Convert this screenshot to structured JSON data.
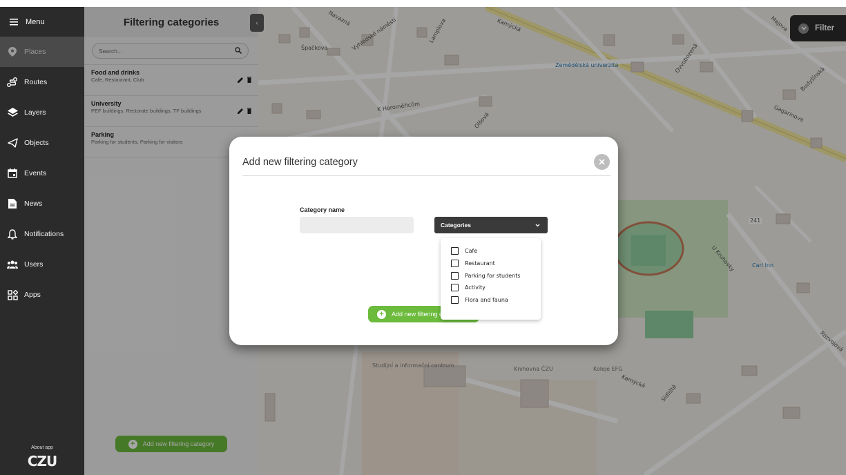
{
  "menu": {
    "title": "Menu",
    "items": [
      {
        "label": "Places",
        "icon": "map-pin-icon",
        "active": true
      },
      {
        "label": "Routes",
        "icon": "route-icon"
      },
      {
        "label": "Layers",
        "icon": "layers-icon"
      },
      {
        "label": "Objects",
        "icon": "objects-icon"
      },
      {
        "label": "Events",
        "icon": "calendar-icon"
      },
      {
        "label": "News",
        "icon": "news-icon"
      },
      {
        "label": "Notifications",
        "icon": "bell-icon"
      },
      {
        "label": "Users",
        "icon": "users-icon"
      },
      {
        "label": "Apps",
        "icon": "apps-icon"
      }
    ],
    "about": "About app",
    "logo": "CZU"
  },
  "panel": {
    "title": "Filtering categories",
    "search_placeholder": "Search...",
    "categories": [
      {
        "title": "Food and drinks",
        "subtitle": "Cafe, Restaurant, Club"
      },
      {
        "title": "University",
        "subtitle": "PEF buildings, Rectorate buildings, TF buildings"
      },
      {
        "title": "Parking",
        "subtitle": "Parking for students, Parking for visitors"
      }
    ],
    "add_button": "Add new filtering category"
  },
  "modal": {
    "title": "Add new filtering category",
    "category_name_label": "Category name",
    "category_name_value": "",
    "dropdown_label": "Categories",
    "options": [
      "Cafe",
      "Restaurant",
      "Parking for students",
      "Activity",
      "Flora and fauna"
    ],
    "add_button": "Add new filtering category"
  },
  "filter_button": "Filter",
  "map_labels": {
    "l1": "Špačkova",
    "l2": "Vyhledské náměstí",
    "l3": "Navazná",
    "l4": "Lamplova",
    "l5": "Kamýcká",
    "l6": "K Horoměřicům",
    "l7": "Zemědělská univerzita",
    "l8": "Olšová",
    "l9": "Budyšínská",
    "l10": "Gagarinova",
    "l11": "Studijní a informační centrum",
    "l12": "Knihovna ČZU",
    "l13": "Koleje EFG",
    "l14": "Sídliště",
    "l15": "Rozvojová",
    "l16": "U Kruhovky",
    "l17": "Carl Inn",
    "l18": "241",
    "l19": "Kamýcká",
    "l20": "Majova",
    "l21": "Ovvobozená"
  },
  "colors": {
    "sidebar": "#2b2b2b",
    "accent": "#6cbb3c",
    "panel": "#efefef"
  }
}
